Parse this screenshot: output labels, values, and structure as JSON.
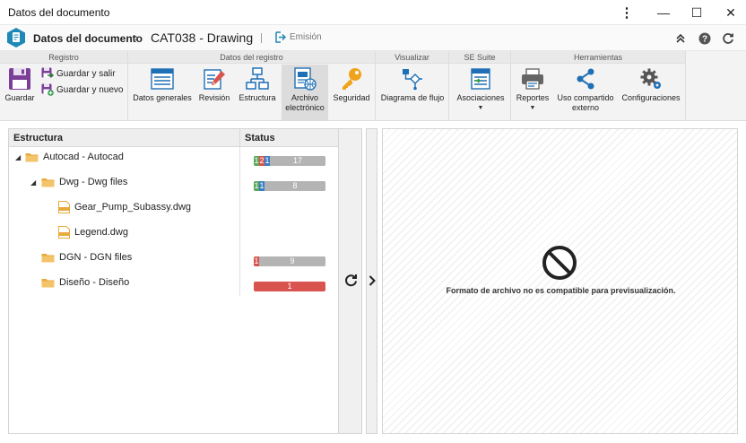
{
  "window": {
    "title": "Datos del documento",
    "controls": [
      "⋮",
      "—",
      "☐",
      "✕"
    ]
  },
  "header": {
    "module": "Datos del documento",
    "document": "CAT038 - Drawing",
    "emission_label": "Emisión"
  },
  "ribbon": {
    "groups": [
      {
        "title": "Registro"
      },
      {
        "title": "Datos del registro"
      },
      {
        "title": "Visualizar"
      },
      {
        "title": "SE Suite"
      },
      {
        "title": "Herramientas"
      }
    ],
    "registro": {
      "save": "Guardar",
      "save_exit": "Guardar y salir",
      "save_new": "Guardar y nuevo"
    },
    "datos": {
      "general": "Datos generales",
      "revision": "Revisión",
      "structure": "Estructura",
      "electronic_file_line1": "Archivo",
      "electronic_file_line2": "electrónico",
      "security": "Seguridad"
    },
    "visualizar": {
      "flow": "Diagrama de flujo"
    },
    "suite": {
      "associations": "Asociaciones"
    },
    "tools": {
      "reports": "Reportes",
      "share_line1": "Uso compartido",
      "share_line2": "externo",
      "settings": "Configuraciones"
    }
  },
  "tree": {
    "col_structure": "Estructura",
    "col_status": "Status",
    "rows": [
      {
        "label": "Autocad - Autocad",
        "status": [
          "1",
          "2",
          "1",
          "17"
        ]
      },
      {
        "label": "Dwg - Dwg files",
        "status": [
          "1",
          "1",
          "8"
        ]
      },
      {
        "label": "Gear_Pump_Subassy.dwg"
      },
      {
        "label": "Legend.dwg"
      },
      {
        "label": "DGN - DGN files",
        "status": [
          "1",
          "9"
        ]
      },
      {
        "label": "Diseño - Diseño",
        "status": [
          "1"
        ]
      }
    ]
  },
  "preview": {
    "message": "Formato de archivo no es compatible para previsualización."
  },
  "colors": {
    "accent": "#1e88b7",
    "status_green": "#5ba85b",
    "status_red": "#d9534f",
    "status_blue": "#3a7ec6",
    "status_gray": "#b4b4b4",
    "folder": "#e8a93c"
  }
}
